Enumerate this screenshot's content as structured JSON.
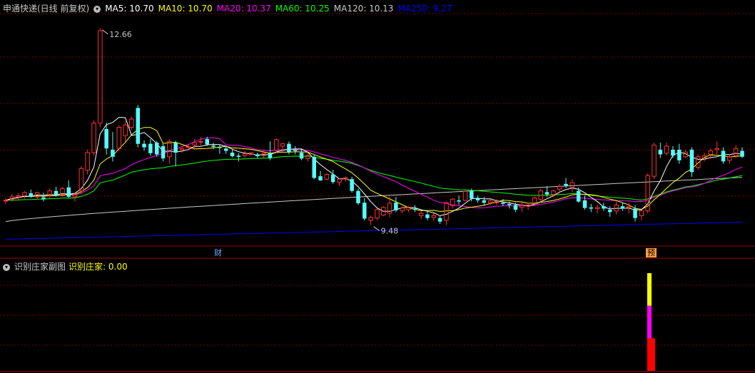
{
  "main_header": {
    "title": "申通快递(日线 前复权)",
    "ma": [
      {
        "label": "MA5: 10.70",
        "color": "#ffffff"
      },
      {
        "label": "MA10: 10.70",
        "color": "#ffff00"
      },
      {
        "label": "MA20: 10.37",
        "color": "#ff00ff"
      },
      {
        "label": "MA60: 10.25",
        "color": "#00ff00"
      },
      {
        "label": "MA120: 10.13",
        "color": "#c8c8c8"
      },
      {
        "label": "MA250: 9.27",
        "color": "#0000ff"
      }
    ]
  },
  "sub_header": {
    "title": "识别庄家副图",
    "value_label": "识别庄家: 0.00",
    "value_color": "#ffff00"
  },
  "markers": {
    "high_label": "12.66",
    "low_label": "9.48",
    "event_cai": "财",
    "event_yu": "预"
  },
  "colors": {
    "up": "#ff3232",
    "down": "#54ffff",
    "grid": "#800000",
    "border": "#a00000"
  },
  "chart_data": {
    "type": "candlestick",
    "ylim": [
      9.0,
      12.9
    ],
    "candles": [
      [
        9.73,
        9.78,
        9.68,
        9.74
      ],
      [
        9.76,
        9.85,
        9.72,
        9.8
      ],
      [
        9.8,
        9.86,
        9.74,
        9.82
      ],
      [
        9.82,
        9.9,
        9.77,
        9.87
      ],
      [
        9.86,
        9.92,
        9.78,
        9.8
      ],
      [
        9.8,
        9.89,
        9.75,
        9.87
      ],
      [
        9.79,
        9.87,
        9.72,
        9.76
      ],
      [
        9.84,
        9.94,
        9.78,
        9.9
      ],
      [
        9.9,
        9.97,
        9.8,
        9.82
      ],
      [
        9.82,
        9.97,
        9.8,
        9.94
      ],
      [
        9.96,
        10.08,
        9.78,
        9.8
      ],
      [
        9.8,
        9.86,
        9.72,
        9.84
      ],
      [
        9.9,
        10.32,
        9.84,
        10.28
      ],
      [
        10.25,
        10.6,
        10.18,
        10.55
      ],
      [
        10.55,
        11.1,
        10.5,
        11.05
      ],
      [
        11.05,
        12.66,
        10.98,
        12.62
      ],
      [
        10.95,
        11.06,
        10.52,
        10.62
      ],
      [
        10.6,
        10.9,
        10.4,
        10.48
      ],
      [
        10.62,
        11.02,
        10.58,
        10.98
      ],
      [
        10.84,
        11.09,
        10.73,
        11.02
      ],
      [
        10.98,
        11.16,
        10.94,
        11.12
      ],
      [
        11.31,
        11.36,
        10.64,
        10.7
      ],
      [
        10.7,
        10.76,
        10.58,
        10.64
      ],
      [
        10.7,
        10.78,
        10.5,
        10.54
      ],
      [
        10.72,
        10.75,
        10.48,
        10.52
      ],
      [
        10.66,
        10.7,
        10.4,
        10.45
      ],
      [
        10.48,
        10.78,
        10.36,
        10.74
      ],
      [
        10.72,
        10.75,
        10.32,
        10.55
      ],
      [
        10.6,
        10.66,
        10.55,
        10.62
      ],
      [
        10.64,
        10.7,
        10.58,
        10.65
      ],
      [
        10.68,
        10.78,
        10.6,
        10.72
      ],
      [
        10.73,
        10.82,
        10.65,
        10.74
      ],
      [
        10.78,
        10.82,
        10.66,
        10.69
      ],
      [
        10.67,
        10.72,
        10.61,
        10.65
      ],
      [
        10.65,
        10.68,
        10.53,
        10.63
      ],
      [
        10.62,
        10.65,
        10.53,
        10.58
      ],
      [
        10.55,
        10.6,
        10.47,
        10.49
      ],
      [
        10.5,
        10.54,
        10.4,
        10.48
      ],
      [
        10.5,
        10.58,
        10.46,
        10.53
      ],
      [
        10.52,
        10.56,
        10.5,
        10.55
      ],
      [
        10.52,
        10.55,
        10.46,
        10.49
      ],
      [
        10.5,
        10.6,
        10.46,
        10.54
      ],
      [
        10.54,
        10.74,
        10.42,
        10.46
      ],
      [
        10.59,
        10.79,
        10.55,
        10.77
      ],
      [
        10.66,
        10.71,
        10.56,
        10.7
      ],
      [
        10.7,
        10.74,
        10.52,
        10.56
      ],
      [
        10.6,
        10.66,
        10.52,
        10.58
      ],
      [
        10.55,
        10.62,
        10.42,
        10.45
      ],
      [
        10.45,
        10.54,
        10.4,
        10.5
      ],
      [
        10.48,
        10.52,
        10.1,
        10.12
      ],
      [
        10.15,
        10.24,
        10.07,
        10.08
      ],
      [
        10.1,
        10.2,
        10.08,
        10.18
      ],
      [
        10.18,
        10.26,
        10.02,
        10.05
      ],
      [
        10.05,
        10.12,
        9.98,
        10.1
      ],
      [
        10.1,
        10.15,
        10.06,
        10.12
      ],
      [
        10.1,
        10.14,
        9.87,
        9.9
      ],
      [
        9.9,
        9.94,
        9.66,
        9.69
      ],
      [
        9.7,
        9.78,
        9.4,
        9.43
      ],
      [
        9.4,
        9.48,
        9.32,
        9.45
      ],
      [
        9.44,
        9.6,
        9.4,
        9.58
      ],
      [
        9.49,
        9.64,
        9.47,
        9.62
      ],
      [
        9.52,
        9.8,
        9.45,
        9.69
      ],
      [
        9.7,
        9.8,
        9.54,
        9.57
      ],
      [
        9.56,
        9.64,
        9.52,
        9.61
      ],
      [
        9.58,
        9.64,
        9.54,
        9.62
      ],
      [
        9.6,
        9.66,
        9.54,
        9.58
      ],
      [
        9.48,
        9.56,
        9.42,
        9.52
      ],
      [
        9.5,
        9.56,
        9.4,
        9.44
      ],
      [
        9.45,
        9.52,
        9.39,
        9.48
      ],
      [
        9.44,
        9.47,
        9.34,
        9.38
      ],
      [
        9.4,
        9.72,
        9.32,
        9.7
      ],
      [
        9.65,
        9.78,
        9.6,
        9.76
      ],
      [
        9.74,
        9.82,
        9.66,
        9.72
      ],
      [
        9.74,
        9.9,
        9.72,
        9.89
      ],
      [
        9.9,
        9.94,
        9.72,
        9.77
      ],
      [
        9.78,
        9.82,
        9.7,
        9.74
      ],
      [
        9.74,
        9.8,
        9.66,
        9.7
      ],
      [
        9.7,
        9.76,
        9.66,
        9.73
      ],
      [
        9.7,
        9.76,
        9.66,
        9.72
      ],
      [
        9.7,
        9.76,
        9.64,
        9.68
      ],
      [
        9.68,
        9.72,
        9.6,
        9.66
      ],
      [
        9.66,
        9.7,
        9.54,
        9.58
      ],
      [
        9.62,
        9.7,
        9.54,
        9.66
      ],
      [
        9.64,
        9.7,
        9.58,
        9.66
      ],
      [
        9.68,
        9.8,
        9.64,
        9.78
      ],
      [
        9.76,
        9.94,
        9.7,
        9.9
      ],
      [
        9.88,
        9.98,
        9.8,
        9.84
      ],
      [
        9.84,
        9.92,
        9.8,
        9.9
      ],
      [
        9.93,
        10.02,
        9.86,
        9.98
      ],
      [
        10.02,
        10.12,
        9.95,
        9.99
      ],
      [
        9.96,
        10.1,
        9.88,
        10.04
      ],
      [
        9.9,
        9.96,
        9.7,
        9.72
      ],
      [
        9.74,
        9.82,
        9.58,
        9.61
      ],
      [
        9.62,
        9.68,
        9.54,
        9.6
      ],
      [
        9.6,
        9.66,
        9.52,
        9.62
      ],
      [
        9.64,
        9.7,
        9.56,
        9.6
      ],
      [
        9.58,
        9.64,
        9.46,
        9.54
      ],
      [
        9.56,
        9.72,
        9.5,
        9.66
      ],
      [
        9.64,
        9.7,
        9.56,
        9.6
      ],
      [
        9.62,
        9.7,
        9.52,
        9.64
      ],
      [
        9.6,
        9.66,
        9.38,
        9.44
      ],
      [
        9.48,
        9.58,
        9.4,
        9.56
      ],
      [
        9.56,
        10.2,
        9.52,
        10.16
      ],
      [
        10.15,
        10.72,
        10.1,
        10.68
      ],
      [
        10.6,
        10.72,
        10.46,
        10.52
      ],
      [
        10.54,
        10.72,
        10.5,
        10.66
      ],
      [
        10.6,
        10.66,
        10.46,
        10.5
      ],
      [
        10.6,
        10.7,
        10.36,
        10.42
      ],
      [
        10.48,
        10.6,
        10.46,
        10.56
      ],
      [
        10.6,
        10.64,
        10.14,
        10.22
      ],
      [
        10.3,
        10.52,
        10.26,
        10.48
      ],
      [
        10.46,
        10.55,
        10.4,
        10.5
      ],
      [
        10.52,
        10.62,
        10.44,
        10.58
      ],
      [
        10.6,
        10.74,
        10.52,
        10.62
      ],
      [
        10.58,
        10.64,
        10.36,
        10.4
      ],
      [
        10.42,
        10.52,
        10.36,
        10.48
      ],
      [
        10.5,
        10.68,
        10.46,
        10.62
      ],
      [
        10.58,
        10.64,
        10.46,
        10.48
      ]
    ],
    "ma250_range": [
      9.08,
      9.37
    ],
    "sub_bar": {
      "segments": [
        {
          "color": "#ffff00"
        },
        {
          "color": "#ff00ff"
        },
        {
          "color": "#ff0000"
        }
      ]
    }
  }
}
